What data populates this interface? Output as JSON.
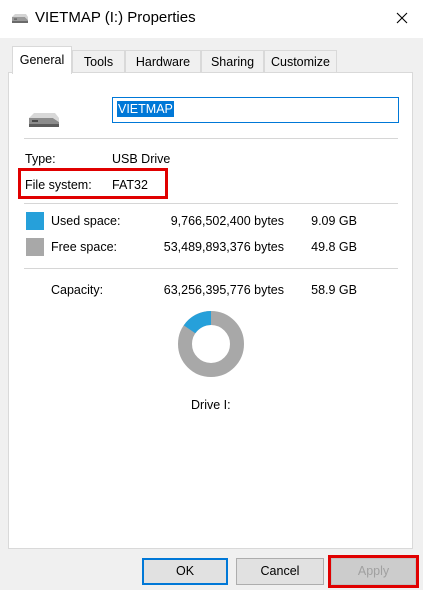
{
  "window": {
    "title": "VIETMAP (I:) Properties",
    "icon": "usb-drive-icon",
    "close_glyph": "✕"
  },
  "tabs": [
    {
      "label": "General",
      "active": true
    },
    {
      "label": "Tools",
      "active": false
    },
    {
      "label": "Hardware",
      "active": false
    },
    {
      "label": "Sharing",
      "active": false
    },
    {
      "label": "Customize",
      "active": false
    }
  ],
  "general": {
    "drive_icon": "usb-drive-icon",
    "volume_name": "VIETMAP",
    "type_label": "Type:",
    "type_value": "USB Drive",
    "fs_label": "File system:",
    "fs_value": "FAT32",
    "used_label": "Used space:",
    "used_bytes": "9,766,502,400 bytes",
    "used_gb": "9.09 GB",
    "used_color": "#26a0da",
    "free_label": "Free space:",
    "free_bytes": "53,489,893,376 bytes",
    "free_gb": "49.8 GB",
    "free_color": "#a8a8a8",
    "capacity_label": "Capacity:",
    "capacity_bytes": "63,256,395,776 bytes",
    "capacity_gb": "58.9 GB",
    "used_fraction": 0.1544,
    "drive_label": "Drive I:",
    "highlight_color": "#e00000"
  },
  "buttons": {
    "ok": "OK",
    "cancel": "Cancel",
    "apply": "Apply"
  }
}
